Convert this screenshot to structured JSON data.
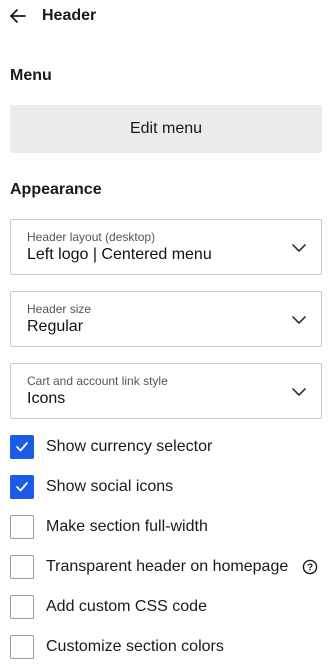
{
  "header": {
    "title": "Header"
  },
  "menu": {
    "heading": "Menu",
    "edit_button": "Edit menu"
  },
  "appearance": {
    "heading": "Appearance",
    "selects": [
      {
        "label": "Header layout (desktop)",
        "value": "Left logo | Centered menu"
      },
      {
        "label": "Header size",
        "value": "Regular"
      },
      {
        "label": "Cart and account link style",
        "value": "Icons"
      }
    ],
    "checkboxes": [
      {
        "label": "Show currency selector",
        "checked": true
      },
      {
        "label": "Show social icons",
        "checked": true
      },
      {
        "label": "Make section full-width",
        "checked": false
      },
      {
        "label": "Transparent header on homepage",
        "checked": false
      },
      {
        "label": "Add custom CSS code",
        "checked": false
      },
      {
        "label": "Customize section colors",
        "checked": false
      }
    ]
  },
  "colors": {
    "accent": "#1a5ce6",
    "button_bg": "#ebebeb",
    "border": "#c9c9c9"
  },
  "icons": {
    "back": "arrow-left-icon",
    "chevron": "chevron-down-icon",
    "help": "question-circle-icon",
    "check": "checkmark-icon"
  }
}
